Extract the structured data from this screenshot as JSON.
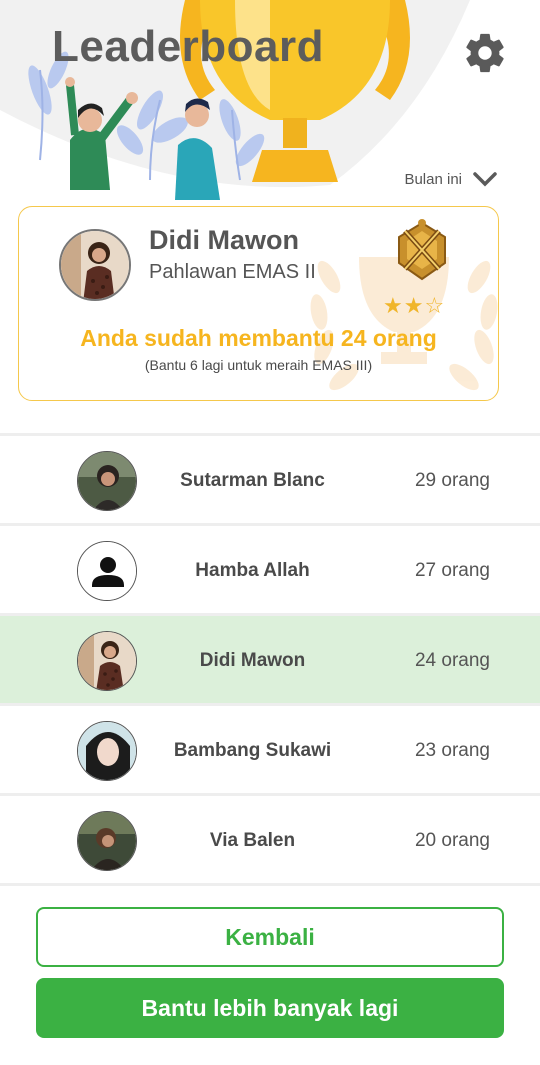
{
  "header": {
    "title": "Leaderboard"
  },
  "filter": {
    "label": "Bulan ini"
  },
  "profile": {
    "name": "Didi Mawon",
    "rank": "Pahlawan EMAS II",
    "stars_filled": 2,
    "stars_total": 3,
    "helped_text": "Anda sudah membantu 24 orang",
    "hint_text": "(Bantu 6 lagi untuk meraih EMAS III)"
  },
  "leaderboard": [
    {
      "name": "Sutarman Blanc",
      "count": "29 orang",
      "avatar": "photo-dark"
    },
    {
      "name": "Hamba Allah",
      "count": "27 orang",
      "avatar": "anonymous-user-icon"
    },
    {
      "name": "Didi Mawon",
      "count": "24 orang",
      "avatar": "photo-brown",
      "current_user": true
    },
    {
      "name": "Bambang Sukawi",
      "count": "23 orang",
      "avatar": "photo-light"
    },
    {
      "name": "Via Balen",
      "count": "20 orang",
      "avatar": "photo-green"
    }
  ],
  "buttons": {
    "back": "Kembali",
    "help_more": "Bantu lebih banyak lagi"
  },
  "colors": {
    "accent_green": "#3bb143",
    "gold": "#f6b51f",
    "highlight_row": "#dcf0da"
  }
}
